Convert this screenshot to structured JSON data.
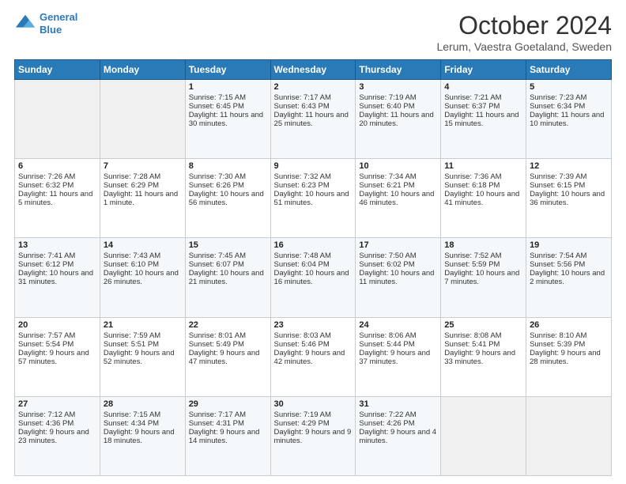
{
  "logo": {
    "line1": "General",
    "line2": "Blue"
  },
  "title": "October 2024",
  "subtitle": "Lerum, Vaestra Goetaland, Sweden",
  "headers": [
    "Sunday",
    "Monday",
    "Tuesday",
    "Wednesday",
    "Thursday",
    "Friday",
    "Saturday"
  ],
  "weeks": [
    [
      {
        "day": "",
        "sunrise": "",
        "sunset": "",
        "daylight": ""
      },
      {
        "day": "",
        "sunrise": "",
        "sunset": "",
        "daylight": ""
      },
      {
        "day": "1",
        "sunrise": "Sunrise: 7:15 AM",
        "sunset": "Sunset: 6:45 PM",
        "daylight": "Daylight: 11 hours and 30 minutes."
      },
      {
        "day": "2",
        "sunrise": "Sunrise: 7:17 AM",
        "sunset": "Sunset: 6:43 PM",
        "daylight": "Daylight: 11 hours and 25 minutes."
      },
      {
        "day": "3",
        "sunrise": "Sunrise: 7:19 AM",
        "sunset": "Sunset: 6:40 PM",
        "daylight": "Daylight: 11 hours and 20 minutes."
      },
      {
        "day": "4",
        "sunrise": "Sunrise: 7:21 AM",
        "sunset": "Sunset: 6:37 PM",
        "daylight": "Daylight: 11 hours and 15 minutes."
      },
      {
        "day": "5",
        "sunrise": "Sunrise: 7:23 AM",
        "sunset": "Sunset: 6:34 PM",
        "daylight": "Daylight: 11 hours and 10 minutes."
      }
    ],
    [
      {
        "day": "6",
        "sunrise": "Sunrise: 7:26 AM",
        "sunset": "Sunset: 6:32 PM",
        "daylight": "Daylight: 11 hours and 5 minutes."
      },
      {
        "day": "7",
        "sunrise": "Sunrise: 7:28 AM",
        "sunset": "Sunset: 6:29 PM",
        "daylight": "Daylight: 11 hours and 1 minute."
      },
      {
        "day": "8",
        "sunrise": "Sunrise: 7:30 AM",
        "sunset": "Sunset: 6:26 PM",
        "daylight": "Daylight: 10 hours and 56 minutes."
      },
      {
        "day": "9",
        "sunrise": "Sunrise: 7:32 AM",
        "sunset": "Sunset: 6:23 PM",
        "daylight": "Daylight: 10 hours and 51 minutes."
      },
      {
        "day": "10",
        "sunrise": "Sunrise: 7:34 AM",
        "sunset": "Sunset: 6:21 PM",
        "daylight": "Daylight: 10 hours and 46 minutes."
      },
      {
        "day": "11",
        "sunrise": "Sunrise: 7:36 AM",
        "sunset": "Sunset: 6:18 PM",
        "daylight": "Daylight: 10 hours and 41 minutes."
      },
      {
        "day": "12",
        "sunrise": "Sunrise: 7:39 AM",
        "sunset": "Sunset: 6:15 PM",
        "daylight": "Daylight: 10 hours and 36 minutes."
      }
    ],
    [
      {
        "day": "13",
        "sunrise": "Sunrise: 7:41 AM",
        "sunset": "Sunset: 6:12 PM",
        "daylight": "Daylight: 10 hours and 31 minutes."
      },
      {
        "day": "14",
        "sunrise": "Sunrise: 7:43 AM",
        "sunset": "Sunset: 6:10 PM",
        "daylight": "Daylight: 10 hours and 26 minutes."
      },
      {
        "day": "15",
        "sunrise": "Sunrise: 7:45 AM",
        "sunset": "Sunset: 6:07 PM",
        "daylight": "Daylight: 10 hours and 21 minutes."
      },
      {
        "day": "16",
        "sunrise": "Sunrise: 7:48 AM",
        "sunset": "Sunset: 6:04 PM",
        "daylight": "Daylight: 10 hours and 16 minutes."
      },
      {
        "day": "17",
        "sunrise": "Sunrise: 7:50 AM",
        "sunset": "Sunset: 6:02 PM",
        "daylight": "Daylight: 10 hours and 11 minutes."
      },
      {
        "day": "18",
        "sunrise": "Sunrise: 7:52 AM",
        "sunset": "Sunset: 5:59 PM",
        "daylight": "Daylight: 10 hours and 7 minutes."
      },
      {
        "day": "19",
        "sunrise": "Sunrise: 7:54 AM",
        "sunset": "Sunset: 5:56 PM",
        "daylight": "Daylight: 10 hours and 2 minutes."
      }
    ],
    [
      {
        "day": "20",
        "sunrise": "Sunrise: 7:57 AM",
        "sunset": "Sunset: 5:54 PM",
        "daylight": "Daylight: 9 hours and 57 minutes."
      },
      {
        "day": "21",
        "sunrise": "Sunrise: 7:59 AM",
        "sunset": "Sunset: 5:51 PM",
        "daylight": "Daylight: 9 hours and 52 minutes."
      },
      {
        "day": "22",
        "sunrise": "Sunrise: 8:01 AM",
        "sunset": "Sunset: 5:49 PM",
        "daylight": "Daylight: 9 hours and 47 minutes."
      },
      {
        "day": "23",
        "sunrise": "Sunrise: 8:03 AM",
        "sunset": "Sunset: 5:46 PM",
        "daylight": "Daylight: 9 hours and 42 minutes."
      },
      {
        "day": "24",
        "sunrise": "Sunrise: 8:06 AM",
        "sunset": "Sunset: 5:44 PM",
        "daylight": "Daylight: 9 hours and 37 minutes."
      },
      {
        "day": "25",
        "sunrise": "Sunrise: 8:08 AM",
        "sunset": "Sunset: 5:41 PM",
        "daylight": "Daylight: 9 hours and 33 minutes."
      },
      {
        "day": "26",
        "sunrise": "Sunrise: 8:10 AM",
        "sunset": "Sunset: 5:39 PM",
        "daylight": "Daylight: 9 hours and 28 minutes."
      }
    ],
    [
      {
        "day": "27",
        "sunrise": "Sunrise: 7:12 AM",
        "sunset": "Sunset: 4:36 PM",
        "daylight": "Daylight: 9 hours and 23 minutes."
      },
      {
        "day": "28",
        "sunrise": "Sunrise: 7:15 AM",
        "sunset": "Sunset: 4:34 PM",
        "daylight": "Daylight: 9 hours and 18 minutes."
      },
      {
        "day": "29",
        "sunrise": "Sunrise: 7:17 AM",
        "sunset": "Sunset: 4:31 PM",
        "daylight": "Daylight: 9 hours and 14 minutes."
      },
      {
        "day": "30",
        "sunrise": "Sunrise: 7:19 AM",
        "sunset": "Sunset: 4:29 PM",
        "daylight": "Daylight: 9 hours and 9 minutes."
      },
      {
        "day": "31",
        "sunrise": "Sunrise: 7:22 AM",
        "sunset": "Sunset: 4:26 PM",
        "daylight": "Daylight: 9 hours and 4 minutes."
      },
      {
        "day": "",
        "sunrise": "",
        "sunset": "",
        "daylight": ""
      },
      {
        "day": "",
        "sunrise": "",
        "sunset": "",
        "daylight": ""
      }
    ]
  ]
}
